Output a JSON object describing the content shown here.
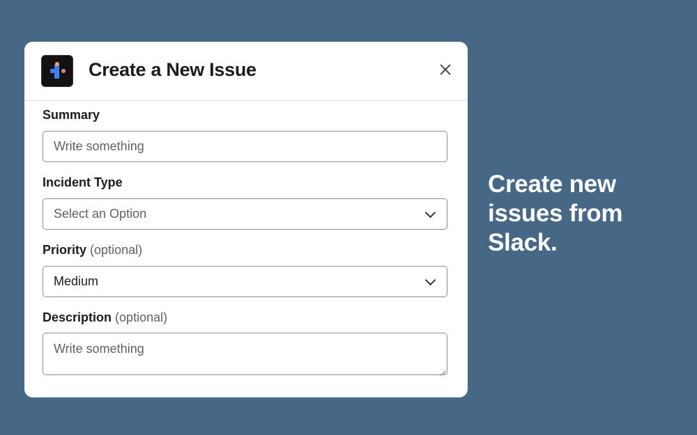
{
  "modal": {
    "title": "Create a New Issue",
    "app_icon": "app-logo-icon",
    "close_icon": "close-icon"
  },
  "fields": {
    "summary": {
      "label": "Summary",
      "placeholder": "Write something"
    },
    "incident_type": {
      "label": "Incident Type",
      "placeholder": "Select an Option"
    },
    "priority": {
      "label": "Priority",
      "optional": "(optional)",
      "value": "Medium"
    },
    "description": {
      "label": "Description",
      "optional": "(optional)",
      "placeholder": "Write something"
    }
  },
  "tagline": "Create new issues from Slack.",
  "colors": {
    "background": "#466886",
    "modal": "#ffffff",
    "app_icon_blue": "#3e7df2",
    "app_icon_orange": "#f0a070"
  }
}
